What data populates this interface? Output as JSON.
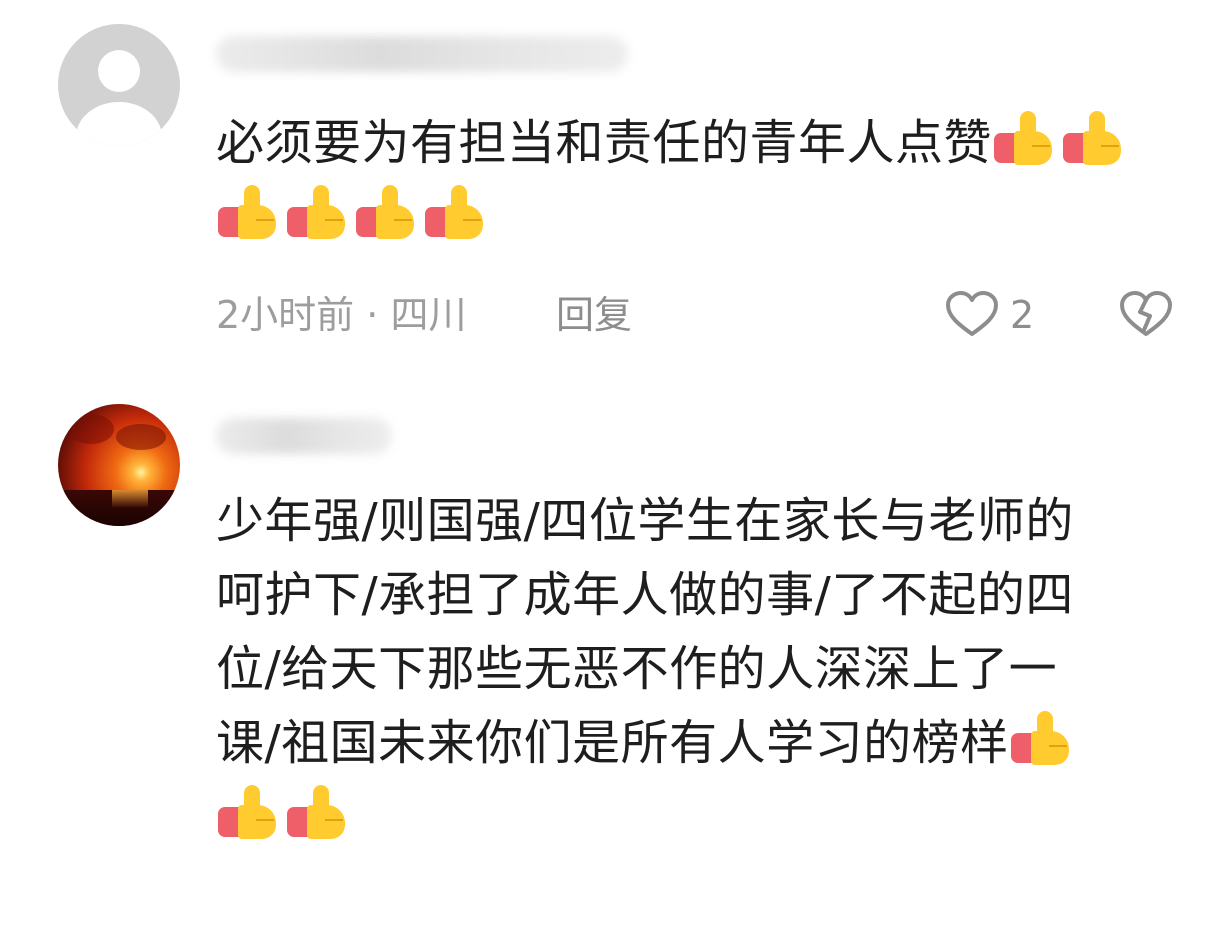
{
  "comments": [
    {
      "avatar": "default-user-avatar",
      "lines": [
        "必须要为有担当和责任的青年人点赞",
        ""
      ],
      "thumbs_per_line": [
        2,
        4
      ],
      "time": "2小时前",
      "location": "四川",
      "meta_sep": " · ",
      "reply_label": "回复",
      "like_count": "2"
    },
    {
      "avatar": "sunset-avatar",
      "lines": [
        "少年强/则国强/四位学生在家长与老师的",
        "呵护下/承担了成年人做的事/了不起的四",
        "位/给天下那些无恶不作的人深深上了一",
        "课/祖国未来你们是所有人学习的榜样",
        ""
      ],
      "thumbs_per_line": [
        0,
        0,
        0,
        1,
        2
      ]
    }
  ],
  "colors": {
    "text": "#1e1e1e",
    "meta": "#9d9d9d",
    "icon": "#8d8d8d",
    "thumb_yellow": "#ffcb2e",
    "thumb_cuff": "#ee5f69"
  },
  "icons": [
    "thumbs-up-emoji",
    "heart-outline-icon",
    "broken-heart-icon"
  ]
}
